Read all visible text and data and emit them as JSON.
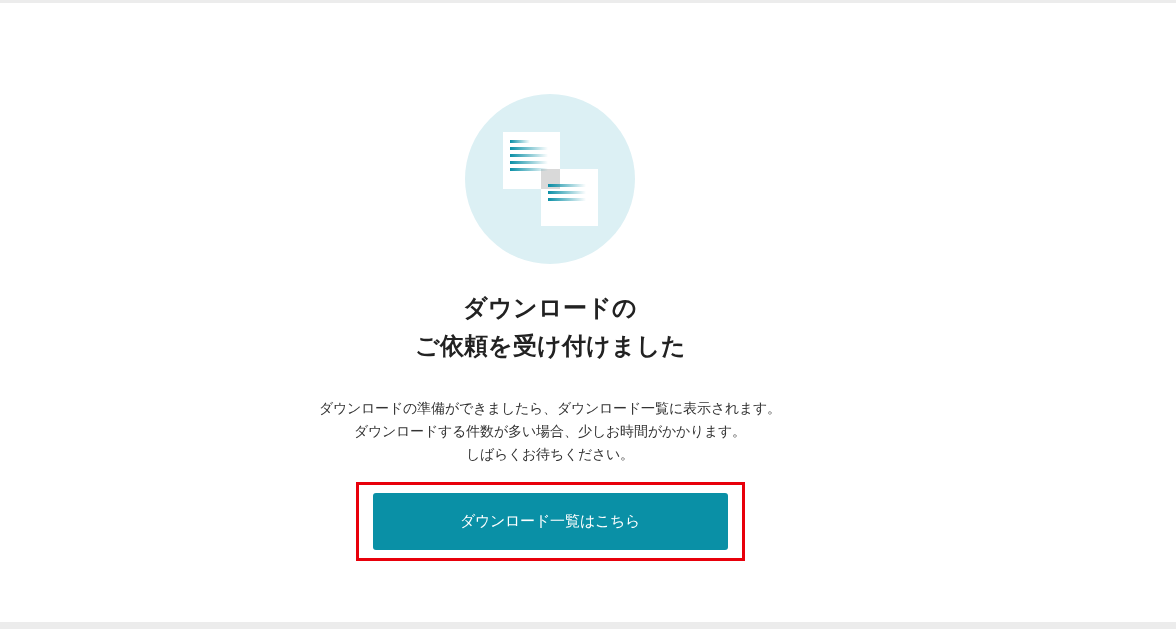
{
  "illustration": {
    "kind": "picture"
  },
  "title_lines": [
    "ダウンロードの",
    "ご依頼を受け付けました"
  ],
  "message_lines": [
    "ダウンロードの準備ができましたら、ダウンロード一覧に表示されます。",
    "ダウンロードする件数が多い場合、少しお時間がかかります。",
    "しばらくお待ちください。"
  ],
  "button": {
    "label": "ダウンロード一覧はこちら",
    "highlighted": true
  }
}
